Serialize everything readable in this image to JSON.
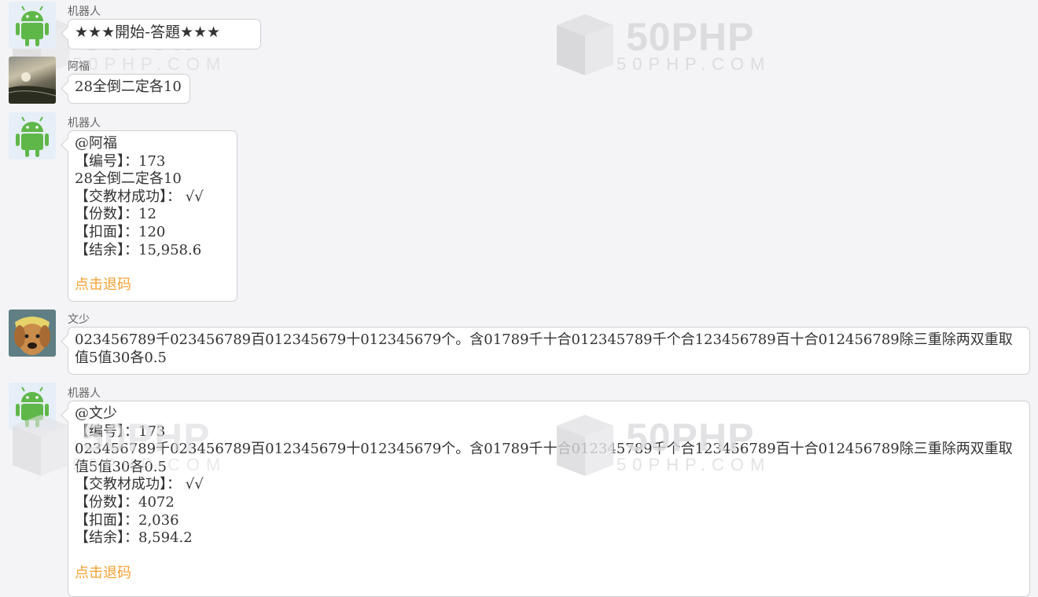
{
  "watermark": {
    "brand": "50PHP",
    "sub": "50PHP.COM"
  },
  "messages": [
    {
      "sender": "机器人",
      "avatar": "android-icon",
      "lines": [
        "★★★開始-答題★★★"
      ]
    },
    {
      "sender": "阿福",
      "avatar": "landscape-photo",
      "lines": [
        "28全倒二定各10"
      ]
    },
    {
      "sender": "机器人",
      "avatar": "android-icon",
      "lines": [
        "@阿福",
        "【编号】：173",
        "28全倒二定各10",
        "【交教材成功】： √√",
        "【份数】：12",
        "【扣面】：120",
        "【结余】：15,958.6"
      ],
      "link": "点击退码"
    },
    {
      "sender": "文少",
      "avatar": "dog-photo",
      "text": "023456789千023456789百012345679十012345679个。含01789千十合012345789千个合123456789百十合012456789除三重除两双重取值5值30各0.5"
    },
    {
      "sender": "机器人",
      "avatar": "android-icon",
      "lines": [
        "@文少",
        "【编号】：173"
      ],
      "text": "023456789千023456789百012345679十012345679个。含01789千十合012345789千个合123456789百十合012456789除三重除两双重取值5值30各0.5",
      "lines2": [
        "【交教材成功】： √√",
        "【份数】：4072",
        "【扣面】：2,036",
        "【结余】：8,594.2"
      ],
      "link": "点击退码"
    }
  ]
}
